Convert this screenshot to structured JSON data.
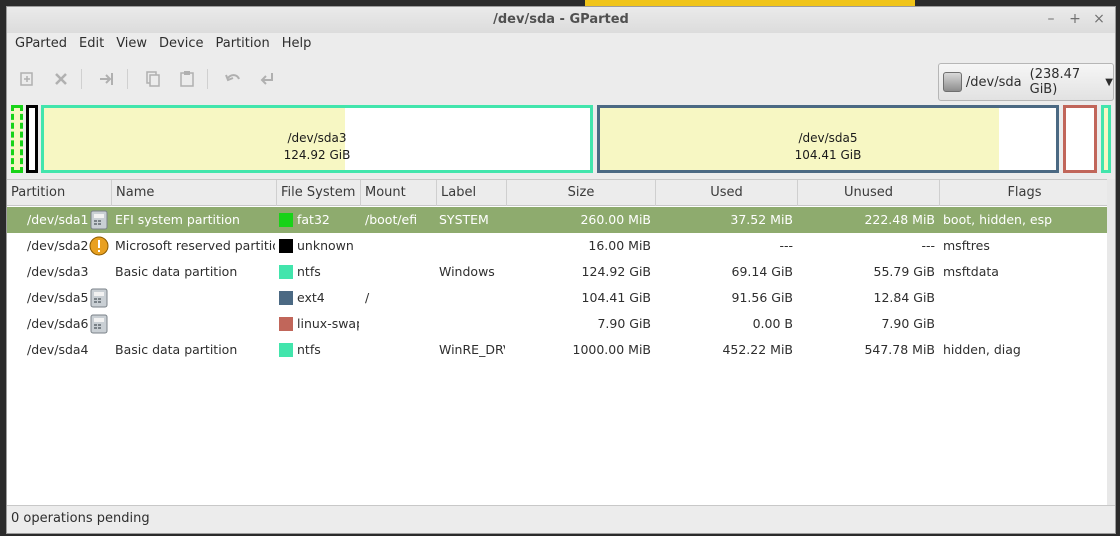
{
  "window": {
    "title": "/dev/sda - GParted"
  },
  "menu": [
    "GParted",
    "Edit",
    "View",
    "Device",
    "Partition",
    "Help"
  ],
  "toolbar": [
    "new-icon",
    "delete-icon",
    "resize-move-icon",
    "copy-icon",
    "paste-icon",
    "undo-icon",
    "apply-icon"
  ],
  "device": {
    "name": "/dev/sda",
    "size": "(238.47 GiB)"
  },
  "diskmap": {
    "sda3": {
      "name": "/dev/sda3",
      "size": "124.92 GiB"
    },
    "sda5": {
      "name": "/dev/sda5",
      "size": "104.41 GiB"
    }
  },
  "columns": [
    "Partition",
    "Name",
    "File System",
    "Mount Point",
    "Label",
    "Size",
    "Used",
    "Unused",
    "Flags"
  ],
  "rows": [
    {
      "partition": "/dev/sda1",
      "icon": "mounted-lock-icon",
      "name": "EFI system partition",
      "fs": "fat32",
      "fs_color": "#18d318",
      "mount": "/boot/efi",
      "label": "SYSTEM",
      "size": "260.00 MiB",
      "used": "37.52 MiB",
      "unused": "222.48 MiB",
      "flags": "boot, hidden, esp"
    },
    {
      "partition": "/dev/sda2",
      "icon": "warning-icon",
      "name": "Microsoft reserved partition",
      "fs": "unknown",
      "fs_color": "#000000",
      "mount": "",
      "label": "",
      "size": "16.00 MiB",
      "used": "---",
      "unused": "---",
      "flags": "msftres"
    },
    {
      "partition": "/dev/sda3",
      "icon": "",
      "name": "Basic data partition",
      "fs": "ntfs",
      "fs_color": "#42e5ac",
      "mount": "",
      "label": "Windows",
      "size": "124.92 GiB",
      "used": "69.14 GiB",
      "unused": "55.79 GiB",
      "flags": "msftdata"
    },
    {
      "partition": "/dev/sda5",
      "icon": "mounted-lock-icon",
      "name": "",
      "fs": "ext4",
      "fs_color": "#4b6983",
      "mount": "/",
      "label": "",
      "size": "104.41 GiB",
      "used": "91.56 GiB",
      "unused": "12.84 GiB",
      "flags": ""
    },
    {
      "partition": "/dev/sda6",
      "icon": "mounted-lock-icon",
      "name": "",
      "fs": "linux-swap",
      "fs_color": "#c1665a",
      "mount": "",
      "label": "",
      "size": "7.90 GiB",
      "used": "0.00 B",
      "unused": "7.90 GiB",
      "flags": ""
    },
    {
      "partition": "/dev/sda4",
      "icon": "",
      "name": "Basic data partition",
      "fs": "ntfs",
      "fs_color": "#42e5ac",
      "mount": "",
      "label": "WinRE_DRV",
      "size": "1000.00 MiB",
      "used": "452.22 MiB",
      "unused": "547.78 MiB",
      "flags": "hidden, diag"
    }
  ],
  "colors": {
    "selection": "#8eab6e",
    "ntfs": "#42e5ac",
    "ext4": "#4b6983",
    "swap": "#c1665a",
    "fat32": "#18d318",
    "used_fill": "#f7f7c3"
  },
  "status": "0 operations pending"
}
